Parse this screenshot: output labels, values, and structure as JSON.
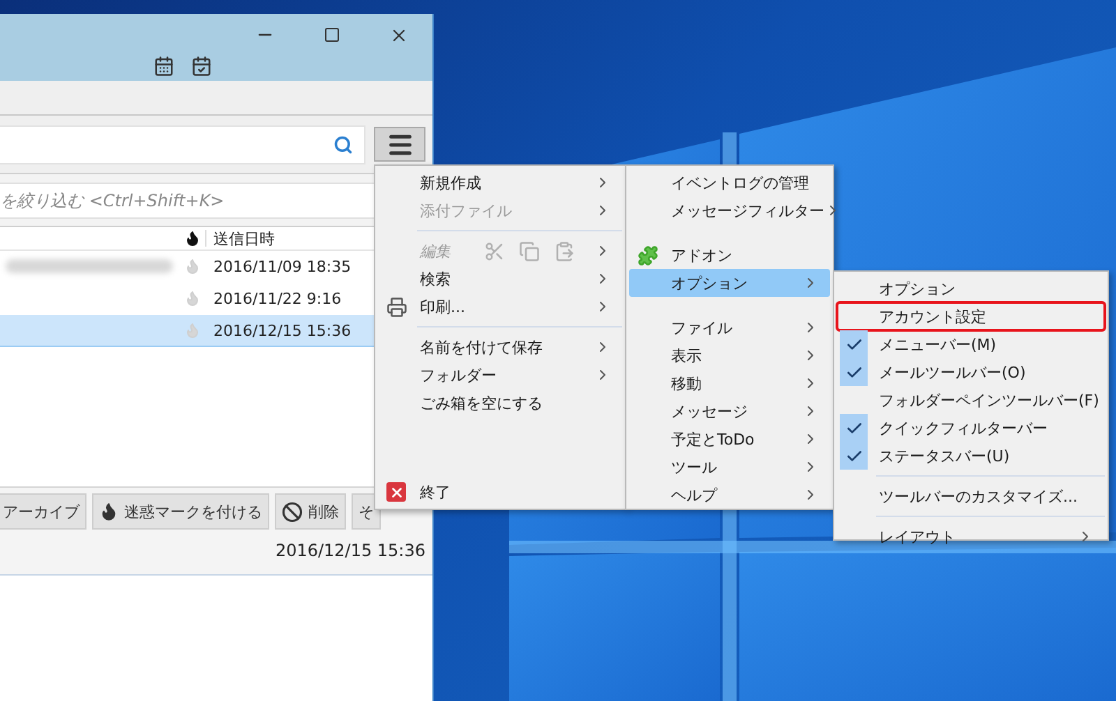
{
  "quick_filter": {
    "placeholder": "を絞り込む <Ctrl+Shift+K>"
  },
  "message_list": {
    "column": "送信日時",
    "rows": [
      {
        "date": "2016/11/09 18:35",
        "selected": false,
        "redacted": true
      },
      {
        "date": "2016/11/22 9:16",
        "selected": false,
        "redacted": false
      },
      {
        "date": "2016/12/15 15:36",
        "selected": true,
        "redacted": false
      }
    ]
  },
  "message_header": {
    "buttons": [
      {
        "kind": "archive",
        "label": "アーカイブ"
      },
      {
        "kind": "junk",
        "label": "迷惑マークを付ける"
      },
      {
        "kind": "delete",
        "label": "削除"
      },
      {
        "kind": "other",
        "label": "そ"
      }
    ],
    "date": "2016/12/15 15:36"
  },
  "app_menu": {
    "items": [
      {
        "kind": "item",
        "label": "新規作成",
        "submenu": true,
        "disabled": false
      },
      {
        "kind": "item",
        "label": "添付ファイル",
        "submenu": true,
        "disabled": true
      },
      {
        "kind": "separator"
      },
      {
        "kind": "edit",
        "label": "編集",
        "submenu": true,
        "disabled": true
      },
      {
        "kind": "item",
        "label": "検索",
        "submenu": true,
        "disabled": false
      },
      {
        "kind": "print",
        "label": "印刷...",
        "submenu": true,
        "disabled": false
      },
      {
        "kind": "separator"
      },
      {
        "kind": "item",
        "label": "名前を付けて保存",
        "submenu": true,
        "disabled": false
      },
      {
        "kind": "item",
        "label": "フォルダー",
        "submenu": true,
        "disabled": false
      },
      {
        "kind": "item",
        "label": "ごみ箱を空にする",
        "submenu": false,
        "disabled": false
      },
      {
        "kind": "spacer"
      },
      {
        "kind": "quit",
        "label": "終了",
        "submenu": false,
        "disabled": false
      }
    ]
  },
  "main_menu": {
    "items": [
      {
        "kind": "item",
        "label": "イベントログの管理",
        "submenu": false,
        "selected": false
      },
      {
        "kind": "item",
        "label": "メッセージフィルター",
        "submenu": true,
        "selected": false
      },
      {
        "kind": "spacer"
      },
      {
        "kind": "addon",
        "label": "アドオン",
        "submenu": false,
        "selected": false
      },
      {
        "kind": "item",
        "label": "オプション",
        "submenu": true,
        "selected": true
      },
      {
        "kind": "spacer"
      },
      {
        "kind": "item",
        "label": "ファイル",
        "submenu": true,
        "selected": false
      },
      {
        "kind": "item",
        "label": "表示",
        "submenu": true,
        "selected": false
      },
      {
        "kind": "item",
        "label": "移動",
        "submenu": true,
        "selected": false
      },
      {
        "kind": "item",
        "label": "メッセージ",
        "submenu": true,
        "selected": false
      },
      {
        "kind": "item",
        "label": "予定とToDo",
        "submenu": true,
        "selected": false
      },
      {
        "kind": "item",
        "label": "ツール",
        "submenu": true,
        "selected": false
      },
      {
        "kind": "item",
        "label": "ヘルプ",
        "submenu": true,
        "selected": false
      }
    ]
  },
  "options_submenu": {
    "items": [
      {
        "kind": "item",
        "label": "オプション",
        "submenu": false,
        "highlighted": false
      },
      {
        "kind": "item",
        "label": "アカウント設定",
        "submenu": false,
        "highlighted": true
      },
      {
        "kind": "check",
        "label": "メニューバー(M)",
        "checked": true
      },
      {
        "kind": "check",
        "label": "メールツールバー(O)",
        "checked": true
      },
      {
        "kind": "check",
        "label": "フォルダーペインツールバー(F)",
        "checked": false
      },
      {
        "kind": "check",
        "label": "クイックフィルターバー",
        "checked": true
      },
      {
        "kind": "check",
        "label": "ステータスバー(U)",
        "checked": true
      },
      {
        "kind": "separator"
      },
      {
        "kind": "item",
        "label": "ツールバーのカスタマイズ...",
        "submenu": false,
        "highlighted": false
      },
      {
        "kind": "separator"
      },
      {
        "kind": "item",
        "label": "レイアウト",
        "submenu": true,
        "highlighted": false
      }
    ]
  }
}
